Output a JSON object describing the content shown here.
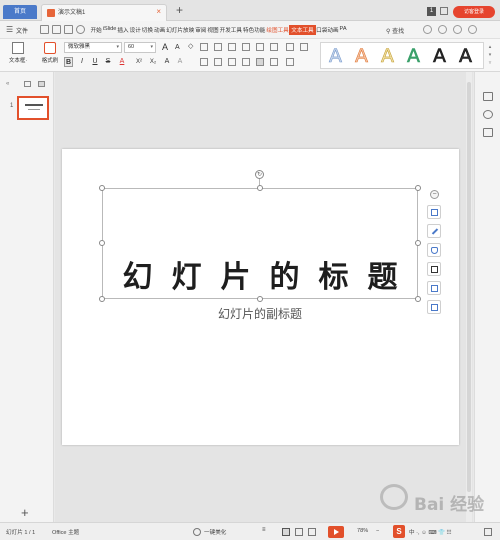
{
  "titlebar": {
    "home_tab": "首页",
    "doc_tab": "演示文稿1",
    "doc_close": "×",
    "new_tab": "+",
    "window_badge": "1",
    "login_button": "访客登录"
  },
  "menubar": {
    "file_menu": "文件",
    "items": [
      "开始",
      "iSlide",
      "插入",
      "设计",
      "切换",
      "动画",
      "幻灯片放映",
      "审阅",
      "视图",
      "开发工具",
      "特色功能",
      "绘图工具",
      "文本工具",
      "口袋动画",
      "PA"
    ],
    "search": "查找"
  },
  "ribbon": {
    "textbox_label": "文本框·",
    "format_painter_label": "格式刷",
    "font_name": "微软雅黑",
    "font_size": "60",
    "grow_font": "A",
    "shrink_font": "A",
    "clear_format": "◇",
    "bold": "B",
    "italic": "I",
    "underline": "U",
    "strike": "S",
    "font_color": "A",
    "superscript": "X²",
    "subscript": "X₂",
    "char_spacing": "A",
    "text_effect": "A",
    "text_styles": [
      {
        "letter": "A",
        "color": "#c9d7ec",
        "outline": "#7a9ccd"
      },
      {
        "letter": "A",
        "color": "#f6c6a8",
        "outline": "#e07a3a"
      },
      {
        "letter": "A",
        "color": "#f3e1a6",
        "outline": "#c4a23a"
      },
      {
        "letter": "A",
        "color": "#3aa06a",
        "outline": "#3aa06a"
      },
      {
        "letter": "A",
        "color": "#222222",
        "outline": "#222222"
      },
      {
        "letter": "A",
        "color": "#333333",
        "outline": "#111111"
      }
    ]
  },
  "slides_panel": {
    "slide_number": "1",
    "add_slide": "+"
  },
  "slide": {
    "title": "幻灯片的标题",
    "subtitle": "幻灯片的副标题",
    "rotate_symbol": "↻",
    "collapse_symbol": "−"
  },
  "statusbar": {
    "slide_count": "幻灯片 1 / 1",
    "theme": "Office 主题",
    "beautify": "一键美化",
    "zoom": "78%",
    "zoom_minus": "−",
    "ime_label": "S",
    "ime_chars": "中 ·, ☺ ⌨ 👕 ☷"
  },
  "watermark": {
    "text": "Bai 经验"
  }
}
